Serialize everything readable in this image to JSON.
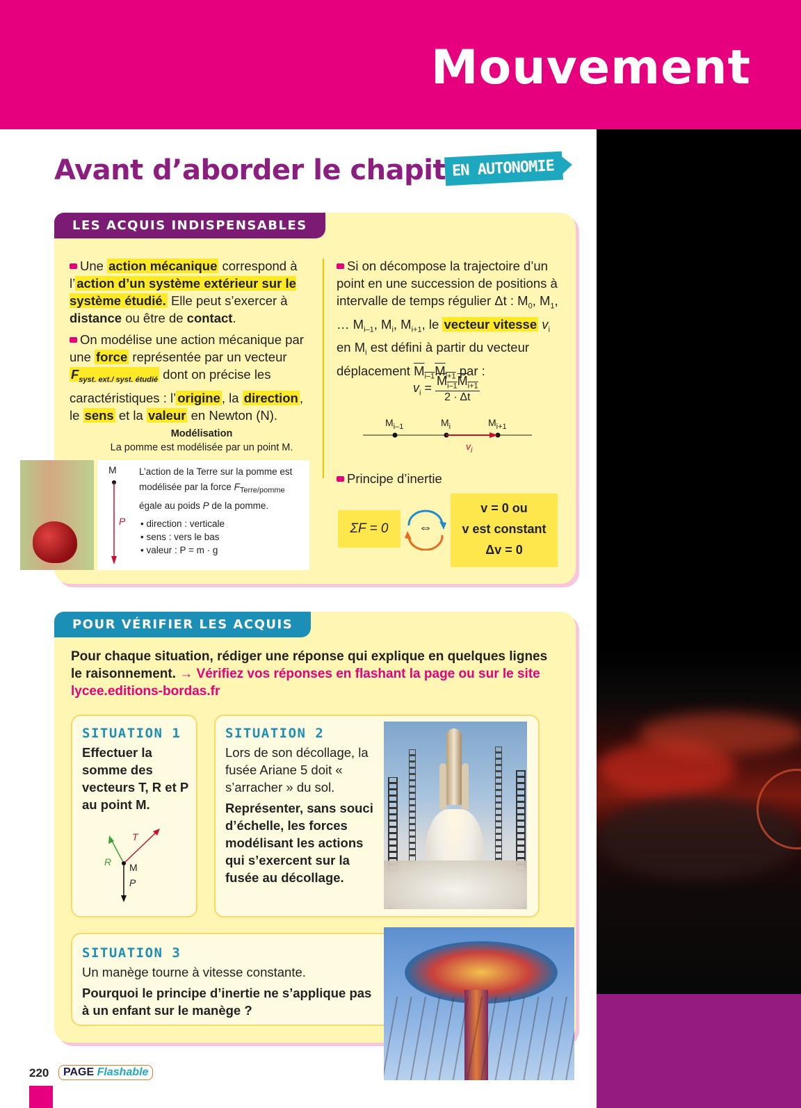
{
  "header": {
    "chapter_title": "Mouvement"
  },
  "section": {
    "title": "Avant d’aborder le chapitre",
    "badge": "EN AUTONOMIE"
  },
  "acquis": {
    "tab": "LES ACQUIS INDISPENSABLES",
    "left": {
      "p1_a": "Une",
      "p1_hl1": "action mécanique",
      "p1_b": "correspond à l’",
      "p1_hl2": "action d’un système extérieur sur le système étudié.",
      "p1_c": "Elle peut s’exercer à",
      "p1_d": "distance",
      "p1_e": "ou être de",
      "p1_f": "contact",
      "p2_a": "On modélise une action mécanique par une",
      "p2_hl1": "force",
      "p2_b": "représentée par un vecteur",
      "p2_vec": "F",
      "p2_vec_sub": "syst. ext./ syst. étudié",
      "p2_c": "dont on précise les caractéristiques : l’",
      "p2_hl2": "origine",
      "p2_d": ", la",
      "p2_hl3": "direction",
      "p2_e": ", le",
      "p2_hl4": "sens",
      "p2_f": "et la",
      "p2_hl5": "valeur",
      "p2_g": "en Newton (N).",
      "model_title": "Modélisation",
      "model_sub": "La pomme est modélisée par un point M.",
      "model_point": "M",
      "model_vec": "P",
      "model_desc1": "L’action de la Terre sur la pomme est modélisée par la force",
      "model_desc_vec": "F",
      "model_desc_sub": "Terre/pomme",
      "model_desc2": "égale au poids",
      "model_desc3": "de la pomme.",
      "model_b1": "• direction : verticale",
      "model_b2": "• sens : vers le bas",
      "model_b3": "• valeur : P = m · g"
    },
    "right": {
      "p1_a": "Si on décompose la trajectoire d’un point en une succession de positions à intervalle de temps régulier Δt : M",
      "p1_b": ", M",
      "p1_c": ", … M",
      "p1_d": ", M",
      "p1_e": ", M",
      "p1_f": ", le",
      "p1_hl": "vecteur vitesse",
      "p1_g": "en M",
      "p1_h": "est défini à partir du vecteur déplacement",
      "p1_i": "par :",
      "sub_0": "0",
      "sub_1": "1",
      "sub_im1": "i–1",
      "sub_i": "i",
      "sub_ip1": "i+1",
      "formula_lhs": "v",
      "formula_num": "M",
      "formula_den": "2 · Δt",
      "axis_m_prev": "M",
      "axis_m_i": "M",
      "axis_m_next": "M",
      "axis_v": "v",
      "inertie_title": "Principe d’inertie",
      "eq_left": "ΣF = 0",
      "eq_arrow": "⇔",
      "eq_r1": "v = 0 ou",
      "eq_r2": "v est constant",
      "eq_r3": "Δv = 0"
    }
  },
  "verifier": {
    "tab": "POUR VÉRIFIER LES ACQUIS",
    "intro_a": "Pour chaque situation, rédiger une réponse qui explique en quelques lignes le raisonnement.",
    "intro_link": "→ Vérifiez vos réponses en flashant la page ou sur le site lycee.editions-bordas.fr",
    "situation1": {
      "title": "SITUATION 1",
      "text": "Effectuer la somme des vecteurs T, R et P au point M.",
      "lbl_T": "T",
      "lbl_R": "R",
      "lbl_P": "P",
      "lbl_M": "M"
    },
    "situation2": {
      "title": "SITUATION 2",
      "text": "Lors de son décollage, la fusée Ariane 5 doit « s’arracher » du sol.",
      "question": "Représenter, sans souci d’échelle, les forces modélisant les actions qui s’exercent sur la fusée au décollage."
    },
    "situation3": {
      "title": "SITUATION 3",
      "text": "Un manège tourne à vitesse constante.",
      "question": "Pourquoi le principe d’inertie ne s’applique pas à un enfant sur le manège ?"
    }
  },
  "footer": {
    "page_number": "220",
    "flash_a": "PAGE",
    "flash_b": "Flashable"
  },
  "colors": {
    "magenta": "#e6007e",
    "purple": "#8b1e7e",
    "teal": "#1ea8bf",
    "yellow_panel": "#fff6b3",
    "highlight": "#fdea25"
  }
}
